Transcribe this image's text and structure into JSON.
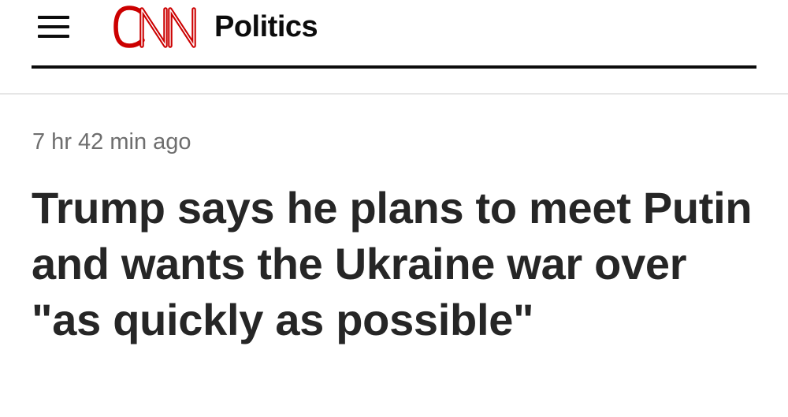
{
  "header": {
    "menu_icon": "hamburger-menu-icon",
    "logo_text": "CNN",
    "logo_color": "#cc0000",
    "section": "Politics"
  },
  "article": {
    "timestamp": "7 hr 42 min ago",
    "headline": "Trump says he plans to meet Putin and wants the Ukraine war over \"as quickly as possible\""
  },
  "colors": {
    "brand": "#cc0000",
    "text": "#262626",
    "muted": "#6e6e6e",
    "rule": "#0c0c0c"
  }
}
